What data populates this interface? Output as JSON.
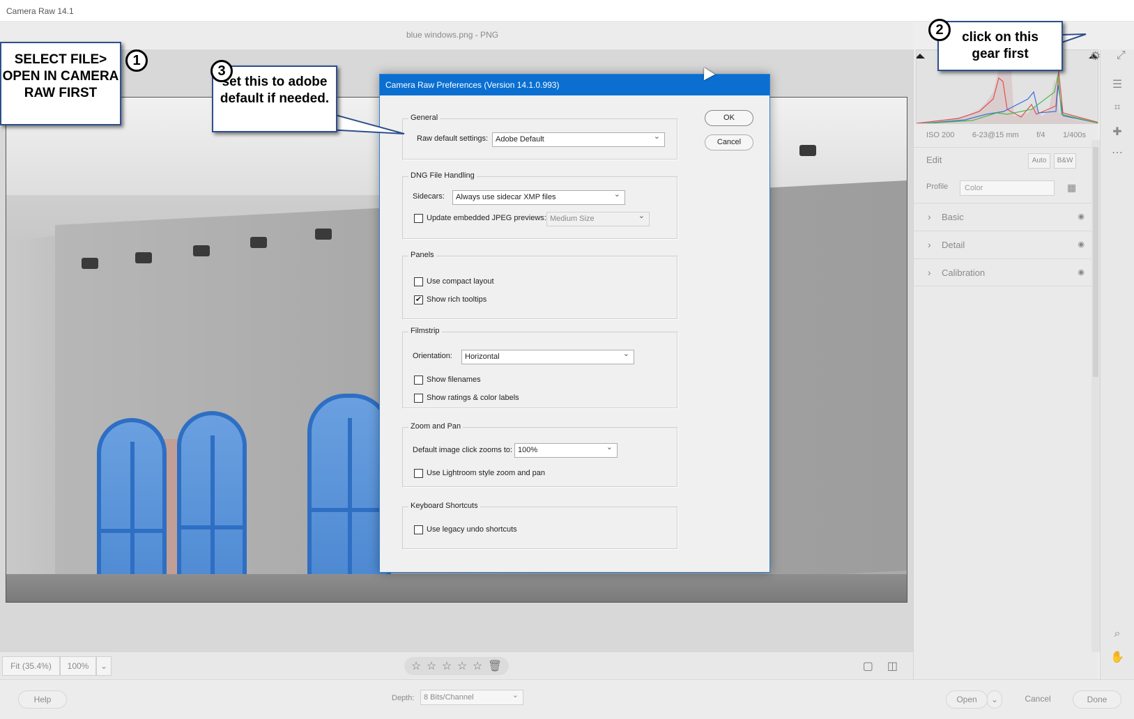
{
  "window": {
    "title": "Camera Raw 14.1"
  },
  "file": {
    "name": "blue windows.png  -  PNG"
  },
  "zoom": {
    "fit": "Fit (35.4%)",
    "percent": "100%"
  },
  "rating": {
    "stars": "☆ ☆ ☆ ☆ ☆",
    "delete_icon": "trash-icon"
  },
  "footer": {
    "help_label": "Help",
    "depth_label": "Depth:",
    "depth_value": "8 Bits/Channel",
    "open_label": "Open",
    "cancel_label": "Cancel",
    "done_label": "Done"
  },
  "exif": {
    "iso": "ISO 200",
    "lens": "6-23@15 mm",
    "aperture": "f/4",
    "shutter": "1/400s"
  },
  "edit_panel": {
    "edit_label": "Edit",
    "auto_label": "Auto",
    "bw_label": "B&W",
    "profile_label": "Profile",
    "profile_value": "Color",
    "sections": [
      "Basic",
      "Detail",
      "Calibration"
    ]
  },
  "dialog": {
    "title": "Camera Raw Preferences  (Version 14.1.0.993)",
    "ok_label": "OK",
    "cancel_label": "Cancel",
    "general": {
      "title": "General",
      "raw_default_label": "Raw default settings:",
      "raw_default_value": "Adobe Default"
    },
    "dng": {
      "title": "DNG File Handling",
      "sidecars_label": "Sidecars:",
      "sidecars_value": "Always use sidecar XMP files",
      "update_jpeg_label": "Update embedded JPEG previews:",
      "update_jpeg_checked": false,
      "preview_size_value": "Medium Size"
    },
    "panels": {
      "title": "Panels",
      "compact_label": "Use compact layout",
      "compact_checked": false,
      "rich_tooltips_label": "Show rich tooltips",
      "rich_tooltips_checked": true
    },
    "filmstrip": {
      "title": "Filmstrip",
      "orientation_label": "Orientation:",
      "orientation_value": "Horizontal",
      "filenames_label": "Show filenames",
      "ratings_label": "Show ratings & color labels"
    },
    "zoom_pan": {
      "title": "Zoom and Pan",
      "default_zoom_label": "Default image click zooms to:",
      "default_zoom_value": "100%",
      "lightroom_label": "Use Lightroom style zoom and pan"
    },
    "shortcuts": {
      "title": "Keyboard Shortcuts",
      "legacy_undo_label": "Use legacy undo shortcuts"
    }
  },
  "annotations": {
    "step1_num": "1",
    "step1_text": "SELECT FILE> OPEN IN CAMERA RAW FIRST",
    "step2_num": "2",
    "step2_text": "click on this gear first",
    "step3_num": "3",
    "step3_text": "set this to adobe default if needed."
  },
  "icons": {
    "gear": "gear-icon",
    "expand": "expand-icon",
    "sliders": "sliders-icon",
    "crop": "crop-icon",
    "heal": "heal-icon",
    "more": "more-icon",
    "zoom": "zoom-icon",
    "hand": "hand-icon"
  }
}
